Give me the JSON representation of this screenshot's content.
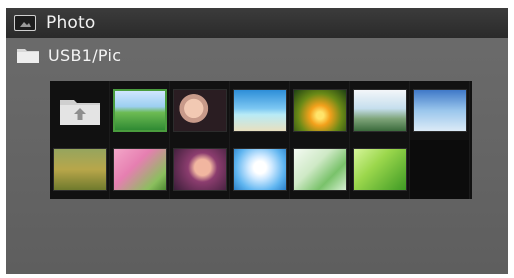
{
  "header": {
    "title": "Photo",
    "icon": "photo-icon"
  },
  "path": {
    "label": "USB1/Pic",
    "icon": "folder-icon"
  },
  "thumbnails": [
    {
      "kind": "up-folder",
      "icon": "up-folder-icon"
    },
    {
      "kind": "image",
      "style": "t-hill",
      "selected": true
    },
    {
      "kind": "image",
      "style": "t-girl"
    },
    {
      "kind": "image",
      "style": "t-beach"
    },
    {
      "kind": "image",
      "style": "t-sunset"
    },
    {
      "kind": "image",
      "style": "t-sunbeach"
    },
    {
      "kind": "image",
      "style": "t-city"
    },
    {
      "kind": "image",
      "style": "t-field"
    },
    {
      "kind": "image",
      "style": "t-blossom"
    },
    {
      "kind": "image",
      "style": "t-portrait"
    },
    {
      "kind": "image",
      "style": "t-flower"
    },
    {
      "kind": "image",
      "style": "t-leaves"
    },
    {
      "kind": "image",
      "style": "t-green"
    },
    {
      "kind": "empty"
    }
  ],
  "colors": {
    "selection": "#4a9c3e",
    "panel": "#666666",
    "titlebar": "#2f2f2f"
  }
}
